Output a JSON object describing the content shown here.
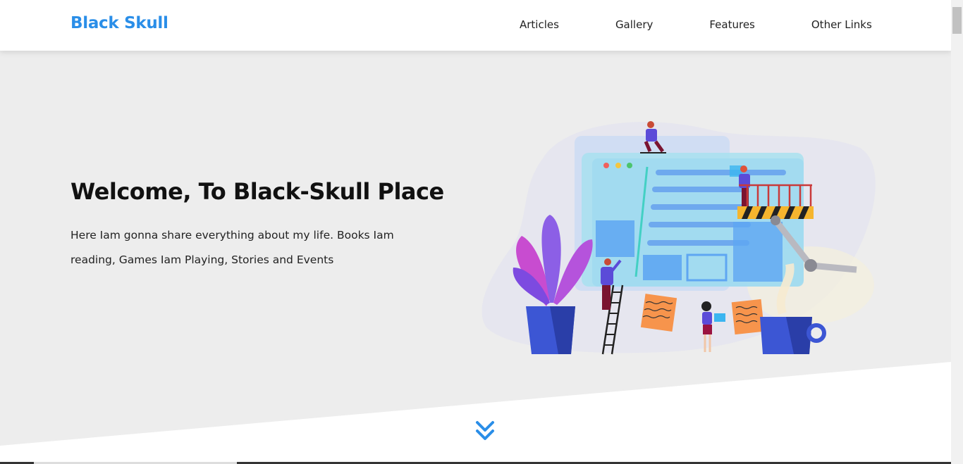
{
  "brand": {
    "name": "Black Skull"
  },
  "nav": {
    "links": [
      {
        "label": "Articles"
      },
      {
        "label": "Gallery"
      },
      {
        "label": "Features"
      },
      {
        "label": "Other Links"
      }
    ]
  },
  "hero": {
    "title": "Welcome, To Black-Skull Place",
    "description": "Here Iam gonna share everything about my life. Books Iam reading, Games Iam Playing, Stories and Events"
  },
  "colors": {
    "brand": "#2a8ee8",
    "hero_bg": "#ededed",
    "accent_arrow": "#2a8ee8"
  },
  "icons": {
    "scroll_down": "double-chevron-down-icon"
  }
}
